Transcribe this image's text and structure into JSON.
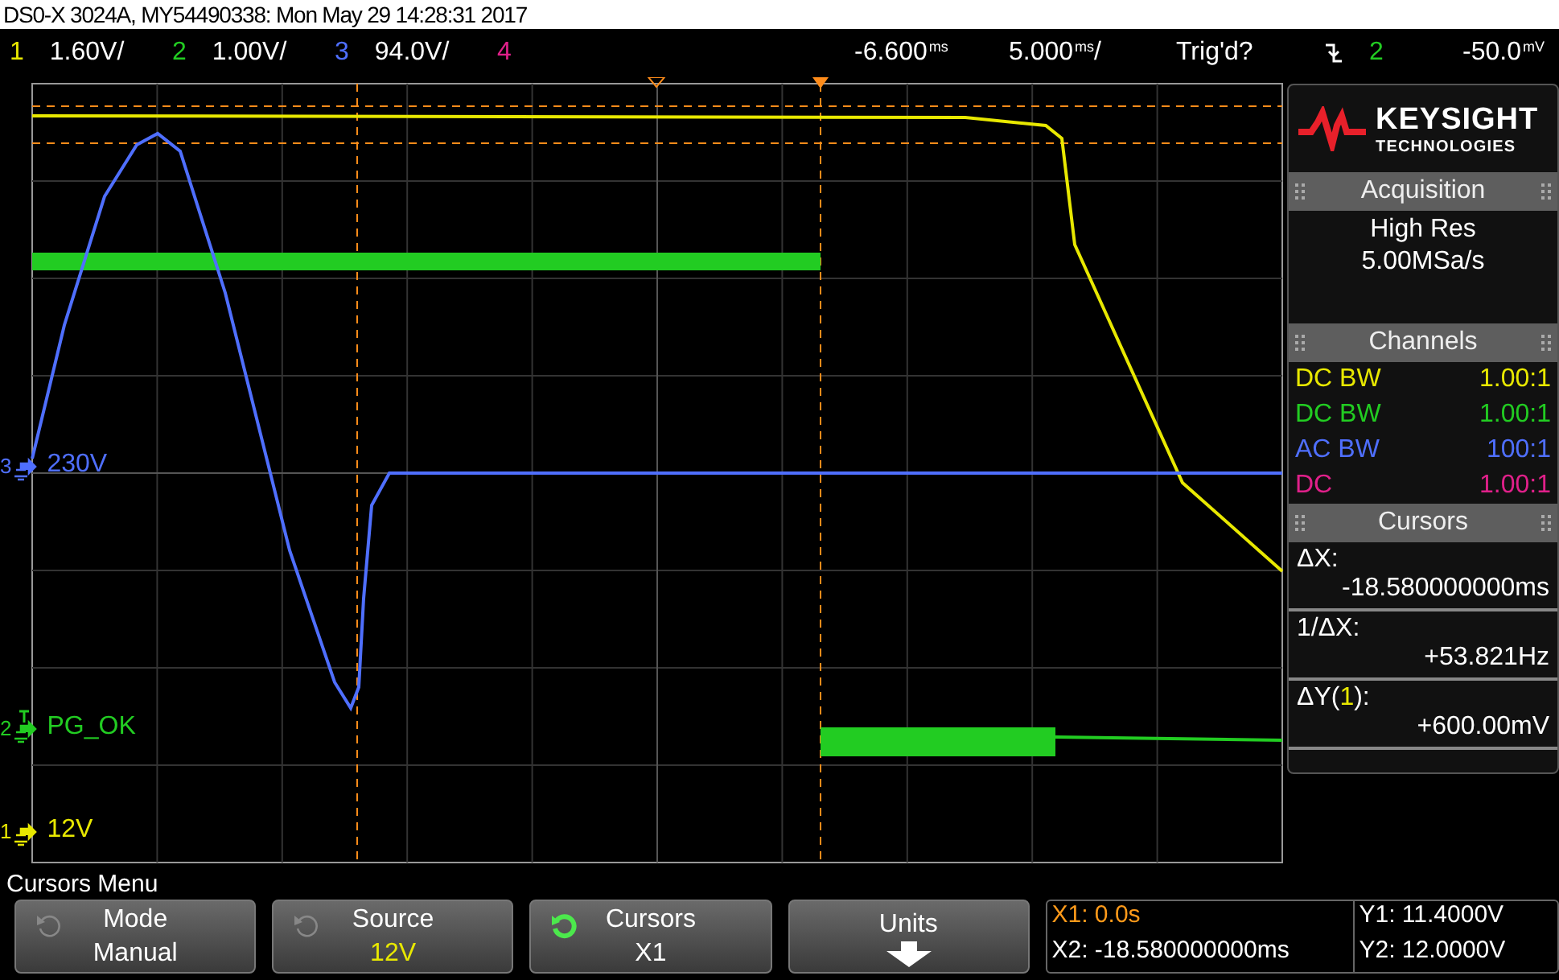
{
  "title": "DS0-X 3024A, MY54490338: Mon May 29 14:28:31 2017",
  "channel_bar": {
    "channels": [
      {
        "number": "1",
        "scale": "1.60V/",
        "color": "#e8e800"
      },
      {
        "number": "2",
        "scale": "1.00V/",
        "color": "#22cc22"
      },
      {
        "number": "3",
        "scale": "94.0V/",
        "color": "#4f6fff"
      },
      {
        "number": "4",
        "color": "#e0208a"
      }
    ],
    "delay": {
      "value": "-6.600",
      "unit": "ms"
    },
    "timebase": {
      "value": "5.000",
      "unit": "ms",
      "suffix": "/"
    },
    "trigger": {
      "status": "Trig'd?",
      "source": "2",
      "level": "-50.0",
      "unit": "mV"
    }
  },
  "graticule": {
    "markers": [
      {
        "number": "3",
        "label": "230V",
        "color": "#4f6fff",
        "trigger": false
      },
      {
        "number": "2",
        "label": "PG_OK",
        "color": "#22cc22",
        "trigger": true
      },
      {
        "number": "1",
        "label": "12V",
        "color": "#e8e800",
        "trigger": false
      }
    ]
  },
  "side_panel": {
    "brand": "KEYSIGHT",
    "brand_sub": "TECHNOLOGIES",
    "acquisition": {
      "title": "Acquisition",
      "mode": "High Res",
      "rate": "5.00MSa/s"
    },
    "channels": {
      "title": "Channels",
      "rows": [
        {
          "coupling": "DC BW",
          "probe": "1.00:1",
          "color": "#e8e800"
        },
        {
          "coupling": "DC BW",
          "probe": "1.00:1",
          "color": "#22cc22"
        },
        {
          "coupling": "AC BW",
          "probe": "100:1",
          "color": "#4f6fff"
        },
        {
          "coupling": "DC",
          "probe": "1.00:1",
          "color": "#e0208a"
        }
      ]
    },
    "cursors": {
      "title": "Cursors",
      "readouts": [
        {
          "label": "ΔX:",
          "value": "-18.580000000ms"
        },
        {
          "label": "1/ΔX:",
          "value": "+53.821Hz"
        },
        {
          "label": "ΔY(",
          "source": "1",
          "label_end": "):",
          "value": "+600.00mV"
        }
      ]
    }
  },
  "menu": {
    "title": "Cursors Menu",
    "softkeys": [
      {
        "kind": "option",
        "title": "Mode",
        "value": "Manual"
      },
      {
        "kind": "source",
        "title": "Source",
        "value": "12V"
      },
      {
        "kind": "toggle",
        "title": "Cursors",
        "value": "X1"
      },
      {
        "kind": "arrow",
        "title": "Units"
      }
    ],
    "readouts": [
      {
        "text": "X1: 0.0s",
        "selected": true
      },
      {
        "text": "Y1: 11.4000V",
        "selected": false
      },
      {
        "text": "X2: -18.580000000ms",
        "selected": false
      },
      {
        "text": "Y2: 12.0000V",
        "selected": false
      }
    ]
  }
}
